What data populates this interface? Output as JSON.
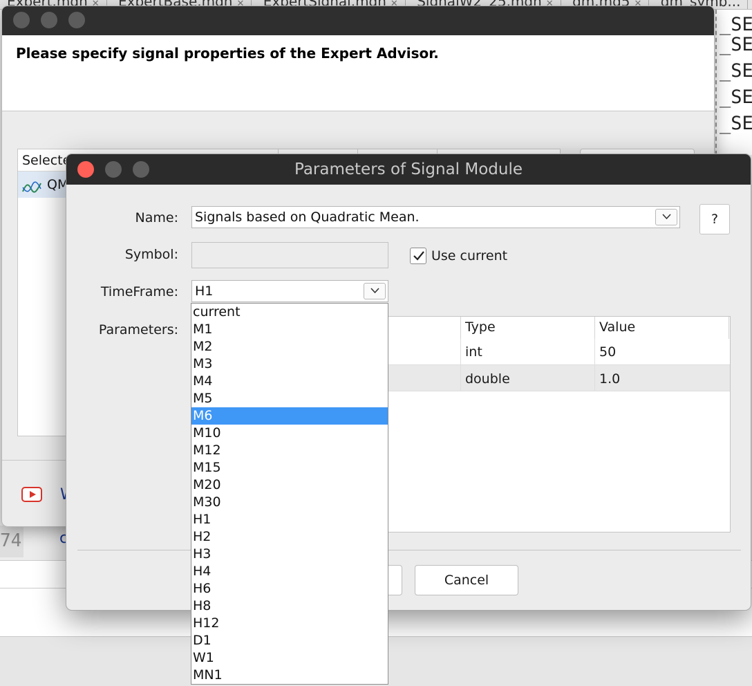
{
  "editor": {
    "tabs": [
      "Expert.mqh",
      "ExpertBase.mqh",
      "ExpertSignal.mqh",
      "SignalW2_25.mqh",
      "qm.mq5",
      "qm_symb..."
    ],
    "right_snippets": [
      "_SE",
      "_SE",
      "_SE",
      "_SE",
      "_SE"
    ],
    "line_number": "74",
    "code_fragment": "c"
  },
  "wizard": {
    "heading": "Please specify signal properties of the Expert Advisor.",
    "list_header": "Selected",
    "list_row": "QM",
    "footer_link": "W"
  },
  "dialog": {
    "title": "Parameters of Signal Module",
    "name_label": "Name:",
    "name_value": "Signals based on Quadratic Mean.",
    "help_label": "?",
    "symbol_label": "Symbol:",
    "symbol_value": "",
    "use_current_label": "Use current",
    "use_current_checked": true,
    "timeframe_label": "TimeFrame:",
    "timeframe_value": "H1",
    "parameters_label": "Parameters:",
    "table": {
      "columns": [
        "Type",
        "Value"
      ],
      "rows": [
        {
          "type": "int",
          "value": "50"
        },
        {
          "type": "double",
          "value": "1.0"
        }
      ]
    },
    "cancel_label": "Cancel"
  },
  "dropdown": {
    "options": [
      "current",
      "M1",
      "M2",
      "M3",
      "M4",
      "M5",
      "M6",
      "M10",
      "M12",
      "M15",
      "M20",
      "M30",
      "H1",
      "H2",
      "H3",
      "H4",
      "H6",
      "H8",
      "H12",
      "D1",
      "W1",
      "MN1"
    ],
    "highlighted": "M6"
  },
  "colors": {
    "highlight": "#3f97f6",
    "close_button": "#fe5f57",
    "titlebar": "#2b2b2b"
  }
}
